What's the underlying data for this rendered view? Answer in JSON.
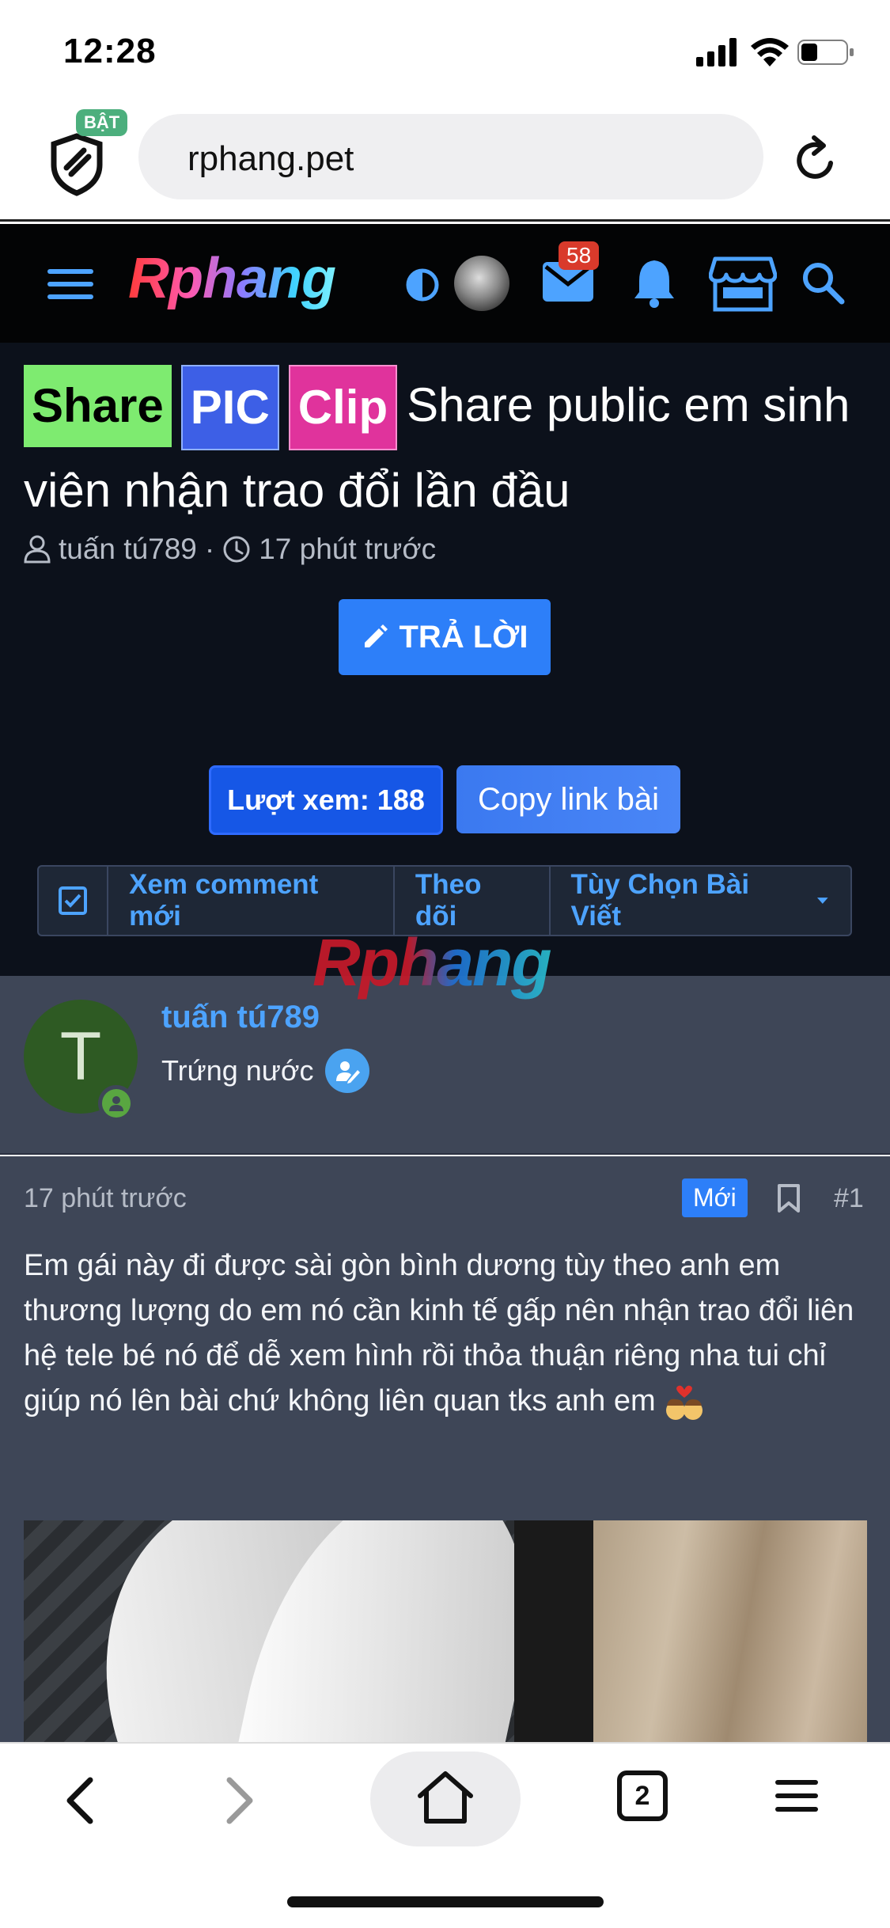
{
  "status_bar": {
    "time": "12:28"
  },
  "browser": {
    "shield_badge": "BẬT",
    "url": "rphang.pet"
  },
  "forum_header": {
    "logo": "Rphang",
    "mail_count": "58"
  },
  "thread": {
    "tags": [
      "Share",
      "PIC",
      "Clip"
    ],
    "title": "Share public em sinh viên nhận trao đổi lần đầu",
    "title_text": "Share public em sinh viên nhận trao đổi lần đầu",
    "author": "tuấn tú789",
    "separator": "·",
    "time": "17 phút trước",
    "reply_label": "TRẢ LỜI",
    "views_label": "Lượt xem: 188",
    "copy_label": "Copy link bài",
    "actions": [
      "Xem comment mới",
      "Theo dõi",
      "Tùy Chọn Bài Viết"
    ]
  },
  "watermark": "Rphang",
  "post": {
    "author_initial": "T",
    "author_name": "tuấn tú789",
    "author_rank": "Trứng nước",
    "time": "17 phút trước",
    "badge": "Mới",
    "number": "#1",
    "body": "Em gái này đi được sài gòn bình dương tùy theo anh em thương lượng do em nó cần kinh tế gấp nên nhận trao đổi liên hệ tele bé nó để dễ xem hình rồi thỏa thuận riêng nha tui chỉ giúp nó lên bài chứ không liên quan tks anh em"
  },
  "toolbar": {
    "tab_count": "2"
  },
  "colors": {
    "accent": "#2d7ff9",
    "link": "#4da3ff",
    "header_bg": "#030405",
    "content_bg": "#3e4657"
  }
}
